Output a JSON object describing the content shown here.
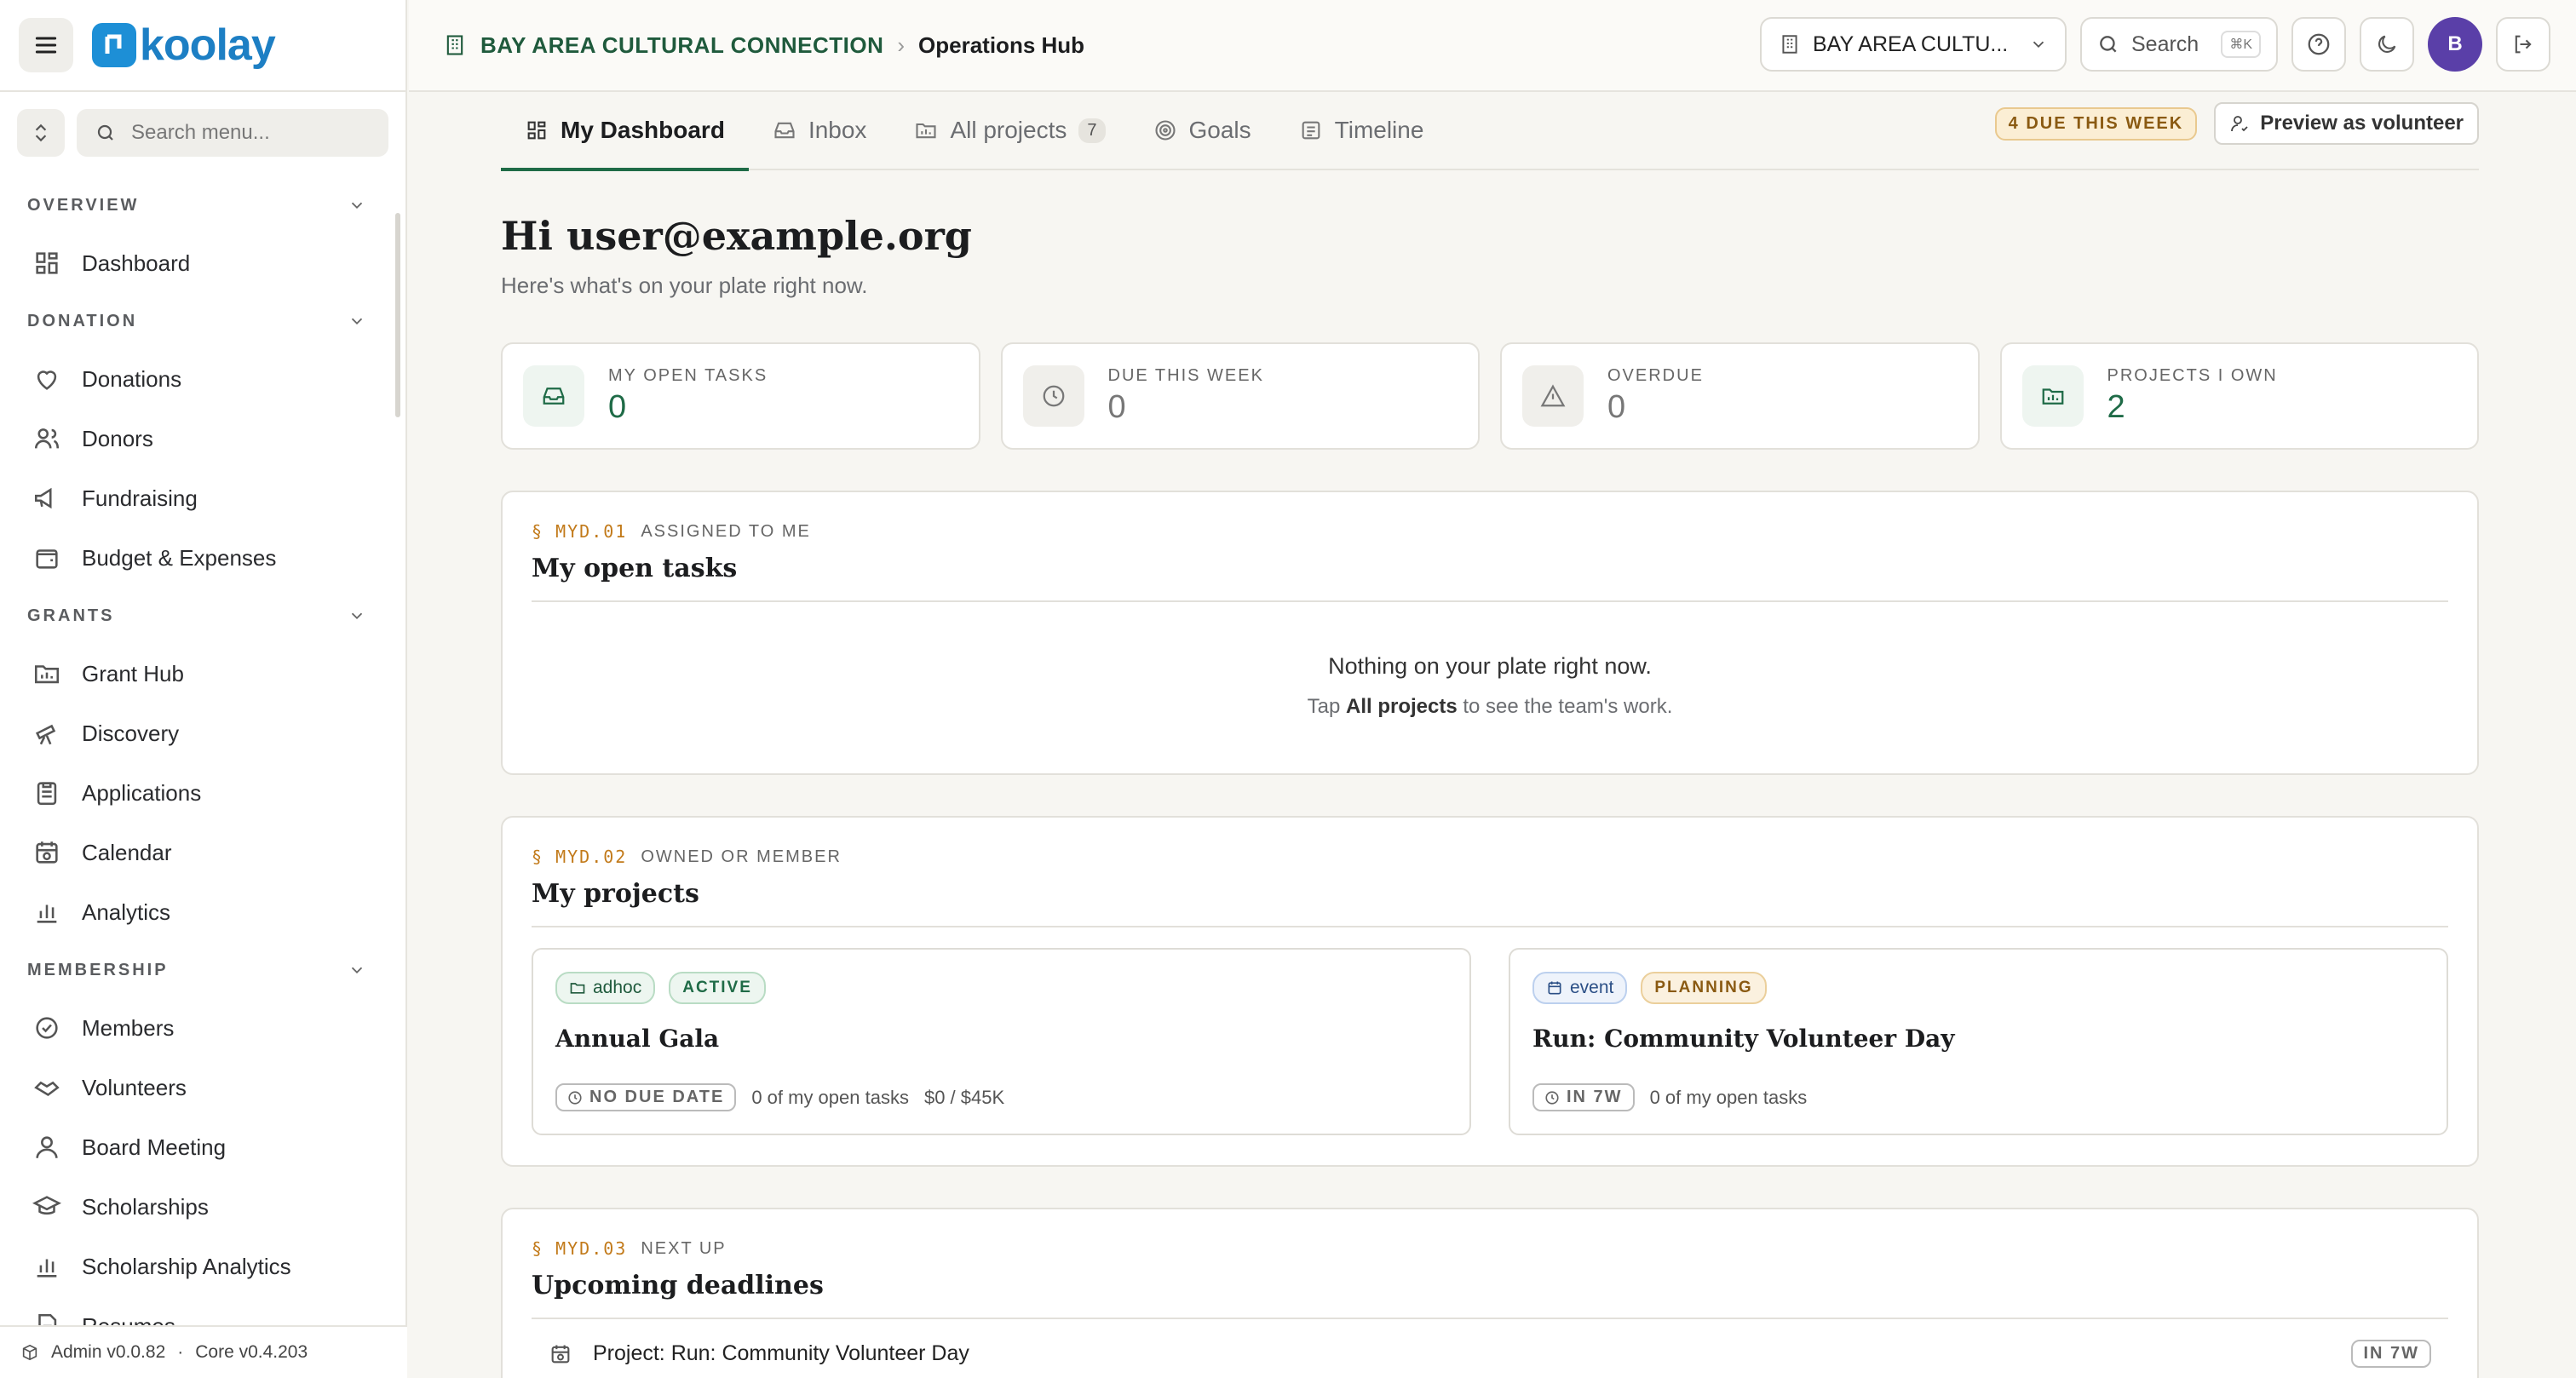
{
  "app": {
    "logo_text": "koolay"
  },
  "sidebar": {
    "search_placeholder": "Search menu...",
    "sections": [
      {
        "title": "OVERVIEW",
        "items": [
          {
            "label": "Dashboard",
            "icon": "grid-icon"
          }
        ]
      },
      {
        "title": "DONATION",
        "items": [
          {
            "label": "Donations",
            "icon": "hand-heart-icon"
          },
          {
            "label": "Donors",
            "icon": "users-icon"
          },
          {
            "label": "Fundraising",
            "icon": "megaphone-icon"
          },
          {
            "label": "Budget & Expenses",
            "icon": "wallet-icon"
          }
        ]
      },
      {
        "title": "GRANTS",
        "items": [
          {
            "label": "Grant Hub",
            "icon": "folder-chart-icon"
          },
          {
            "label": "Discovery",
            "icon": "telescope-icon"
          },
          {
            "label": "Applications",
            "icon": "clipboard-icon"
          },
          {
            "label": "Calendar",
            "icon": "calendar-clock-icon"
          },
          {
            "label": "Analytics",
            "icon": "bar-chart-icon"
          }
        ]
      },
      {
        "title": "MEMBERSHIP",
        "items": [
          {
            "label": "Members",
            "icon": "badge-check-icon"
          },
          {
            "label": "Volunteers",
            "icon": "handshake-icon"
          },
          {
            "label": "Board Meeting",
            "icon": "user-icon"
          },
          {
            "label": "Scholarships",
            "icon": "graduation-cap-icon"
          },
          {
            "label": "Scholarship Analytics",
            "icon": "bar-chart-icon"
          },
          {
            "label": "Resumes",
            "icon": "file-icon"
          }
        ]
      }
    ],
    "footer": {
      "admin_version": "Admin v0.0.82",
      "separator": "·",
      "core_version": "Core v0.4.203"
    }
  },
  "topbar": {
    "org": "BAY AREA CULTURAL CONNECTION",
    "separator": "›",
    "current": "Operations Hub",
    "org_select": "BAY AREA CULTU...",
    "search_label": "Search",
    "search_kbd": "⌘K",
    "avatar_initial": "B"
  },
  "tabs": {
    "items": [
      {
        "label": "My Dashboard",
        "icon": "grid-icon",
        "active": true
      },
      {
        "label": "Inbox",
        "icon": "inbox-icon"
      },
      {
        "label": "All projects",
        "icon": "folder-chart-icon",
        "count": "7"
      },
      {
        "label": "Goals",
        "icon": "target-icon"
      },
      {
        "label": "Timeline",
        "icon": "list-icon"
      }
    ],
    "due_badge": "4 DUE THIS WEEK",
    "preview_button": "Preview as volunteer"
  },
  "main": {
    "greeting": "Hi user@example.org",
    "subtitle": "Here's what's on your plate right now.",
    "stats": [
      {
        "label": "MY OPEN TASKS",
        "value": "0"
      },
      {
        "label": "DUE THIS WEEK",
        "value": "0"
      },
      {
        "label": "OVERDUE",
        "value": "0"
      },
      {
        "label": "PROJECTS I OWN",
        "value": "2"
      }
    ],
    "open_tasks": {
      "code": "§ MYD.01",
      "kicker": "ASSIGNED TO ME",
      "title": "My open tasks",
      "empty_title": "Nothing on your plate right now.",
      "empty_pre": "Tap ",
      "empty_link": "All projects",
      "empty_post": " to see the team's work."
    },
    "projects": {
      "code": "§ MYD.02",
      "kicker": "OWNED OR MEMBER",
      "title": "My projects",
      "cards": [
        {
          "type": "adhoc",
          "status": "ACTIVE",
          "name": "Annual Gala",
          "due": "NO DUE DATE",
          "tasks": "0 of my open tasks",
          "budget": "$0 / $45K"
        },
        {
          "type": "event",
          "status": "PLANNING",
          "name": "Run: Community Volunteer Day",
          "due": "IN 7W",
          "tasks": "0 of my open tasks"
        }
      ]
    },
    "deadlines": {
      "code": "§ MYD.03",
      "kicker": "NEXT UP",
      "title": "Upcoming deadlines",
      "items": [
        {
          "label": "Project: Run: Community Volunteer Day",
          "due": "IN 7W"
        }
      ]
    }
  },
  "colors": {
    "brand": "#1d8fd6",
    "accent_green": "#1f6b47",
    "code_amber": "#c27a1a",
    "avatar": "#5a3fa8"
  }
}
